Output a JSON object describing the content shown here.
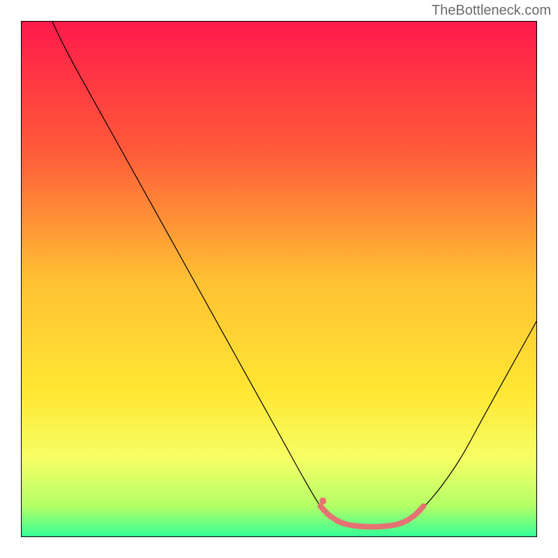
{
  "watermark": "TheBottleneck.com",
  "chart_data": {
    "type": "line",
    "title": "",
    "xlabel": "",
    "ylabel": "",
    "xlim": [
      0,
      100
    ],
    "ylim": [
      0,
      100
    ],
    "background_gradient": {
      "stops": [
        {
          "offset": 0,
          "color": "#ff1a4a"
        },
        {
          "offset": 0.25,
          "color": "#ff5a3a"
        },
        {
          "offset": 0.5,
          "color": "#ffc033"
        },
        {
          "offset": 0.72,
          "color": "#ffe733"
        },
        {
          "offset": 0.85,
          "color": "#f6ff66"
        },
        {
          "offset": 0.94,
          "color": "#b3ff66"
        },
        {
          "offset": 1.0,
          "color": "#33ff99"
        }
      ]
    },
    "series": [
      {
        "name": "curve",
        "color": "#000000",
        "width": 1.2,
        "points": [
          {
            "x": 6,
            "y": 100
          },
          {
            "x": 10,
            "y": 92
          },
          {
            "x": 20,
            "y": 74
          },
          {
            "x": 30,
            "y": 56
          },
          {
            "x": 40,
            "y": 38
          },
          {
            "x": 50,
            "y": 20
          },
          {
            "x": 55,
            "y": 11
          },
          {
            "x": 58,
            "y": 6
          },
          {
            "x": 60,
            "y": 4
          },
          {
            "x": 63,
            "y": 2.5
          },
          {
            "x": 68,
            "y": 2
          },
          {
            "x": 73,
            "y": 2.5
          },
          {
            "x": 76,
            "y": 4
          },
          {
            "x": 80,
            "y": 8
          },
          {
            "x": 85,
            "y": 15
          },
          {
            "x": 90,
            "y": 24
          },
          {
            "x": 95,
            "y": 33
          },
          {
            "x": 100,
            "y": 42
          }
        ]
      },
      {
        "name": "highlight",
        "color": "#e57373",
        "width": 8,
        "points": [
          {
            "x": 58,
            "y": 6
          },
          {
            "x": 60,
            "y": 4
          },
          {
            "x": 63,
            "y": 2.5
          },
          {
            "x": 68,
            "y": 2
          },
          {
            "x": 73,
            "y": 2.5
          },
          {
            "x": 76,
            "y": 4
          },
          {
            "x": 78,
            "y": 6
          }
        ]
      }
    ],
    "marker": {
      "x": 58.5,
      "y": 7,
      "r": 5,
      "color": "#e57373"
    },
    "frame_color": "#000000"
  }
}
